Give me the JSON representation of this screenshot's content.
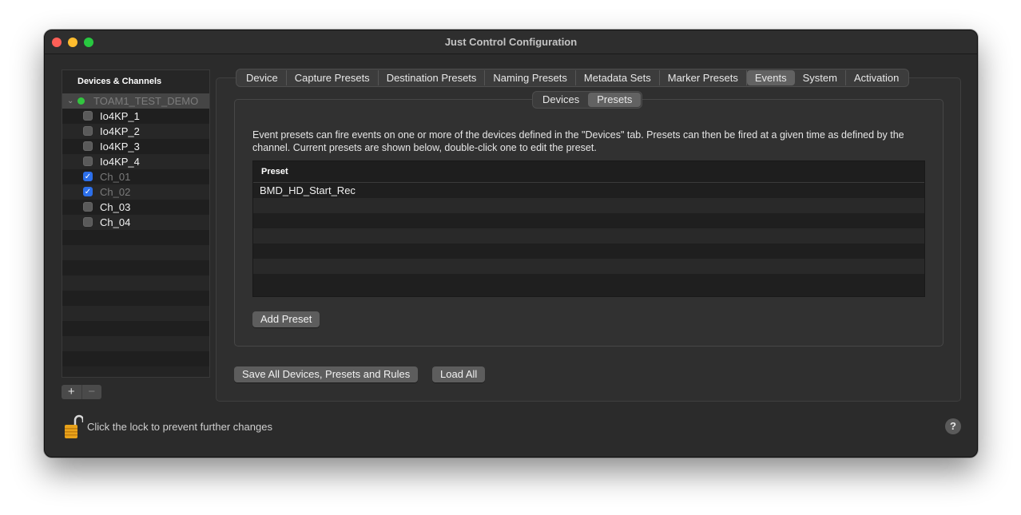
{
  "window": {
    "title": "Just Control Configuration"
  },
  "sidebar": {
    "header": "Devices & Channels",
    "root": {
      "label": "TOAM1_TEST_DEMO",
      "status_color": "#32c53f"
    },
    "items": [
      {
        "label": "Io4KP_1",
        "checked": false,
        "dim": false
      },
      {
        "label": "Io4KP_2",
        "checked": false,
        "dim": false
      },
      {
        "label": "Io4KP_3",
        "checked": false,
        "dim": false
      },
      {
        "label": "Io4KP_4",
        "checked": false,
        "dim": false
      },
      {
        "label": "Ch_01",
        "checked": true,
        "dim": true
      },
      {
        "label": "Ch_02",
        "checked": true,
        "dim": true
      },
      {
        "label": "Ch_03",
        "checked": false,
        "dim": false
      },
      {
        "label": "Ch_04",
        "checked": false,
        "dim": false
      }
    ],
    "add_label": "+",
    "remove_label": "−"
  },
  "tabs": {
    "items": [
      "Device",
      "Capture Presets",
      "Destination Presets",
      "Naming Presets",
      "Metadata Sets",
      "Marker Presets",
      "Events",
      "System",
      "Activation"
    ],
    "active": "Events"
  },
  "subtabs": {
    "items": [
      "Devices",
      "Presets"
    ],
    "active": "Presets"
  },
  "presets": {
    "description": "Event presets can fire events on one or more of the devices defined in the \"Devices\" tab. Presets can then be fired at a given time as defined by the channel. Current presets are shown below, double-click one to edit the preset.",
    "column_header": "Preset",
    "rows": [
      "BMD_HD_Start_Rec"
    ],
    "add_button": "Add Preset"
  },
  "footer": {
    "save_all_button": "Save All Devices, Presets and Rules",
    "load_all_button": "Load All",
    "lock_text": "Click the lock to prevent further changes",
    "help_label": "?"
  },
  "colors": {
    "accent": "#2c6fea",
    "lock": "#e8a21a"
  }
}
